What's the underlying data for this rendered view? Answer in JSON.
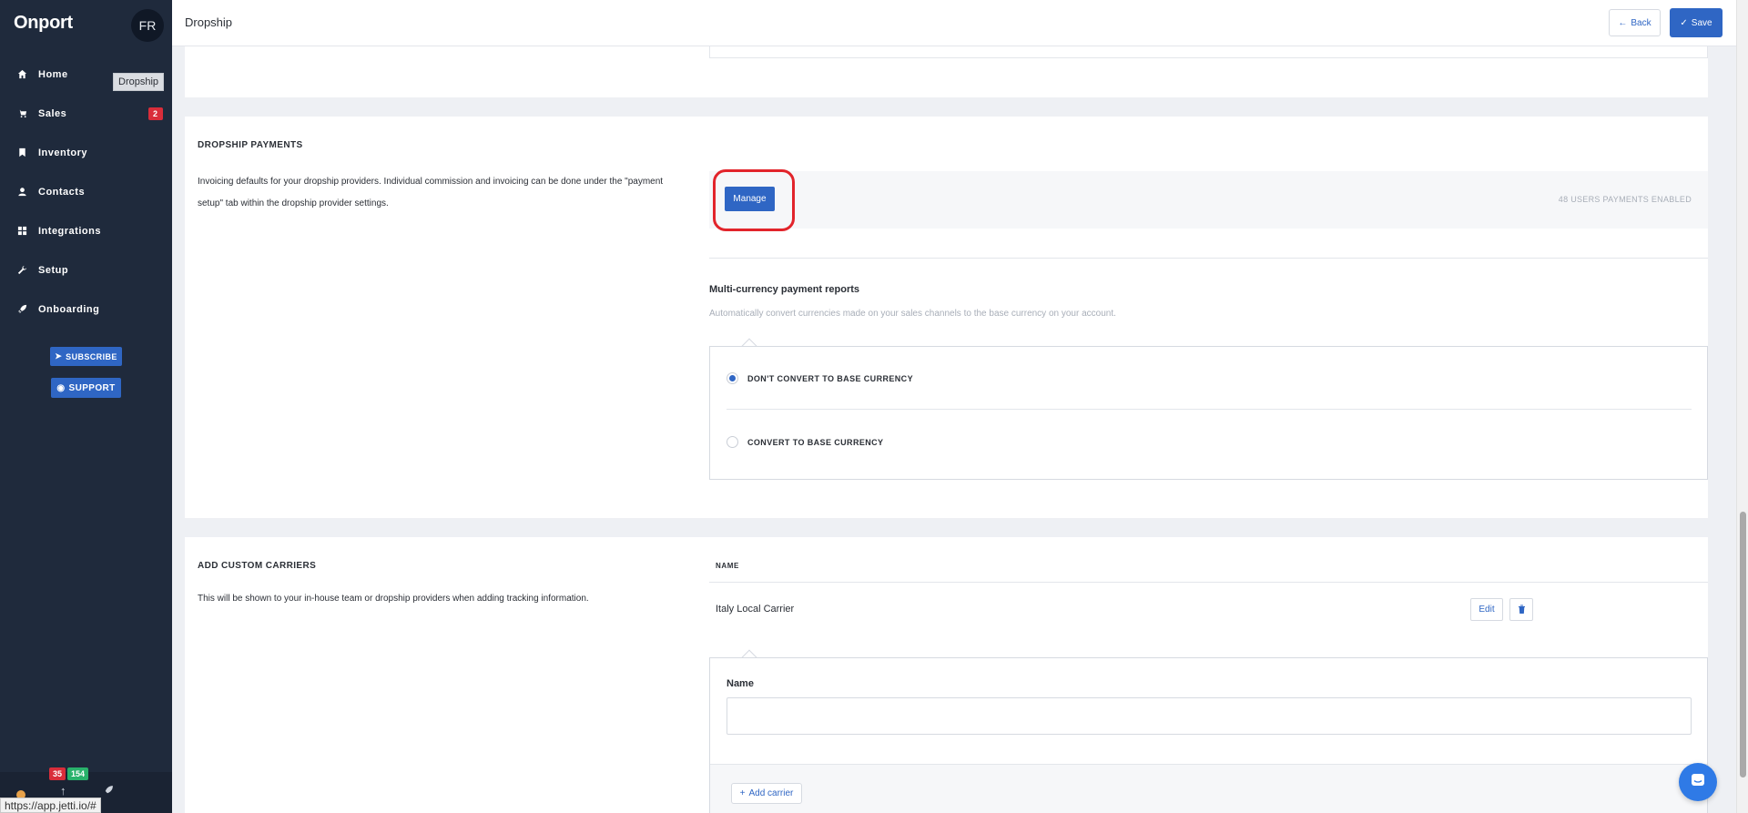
{
  "app": {
    "name": "Onport",
    "avatar_initials": "FR"
  },
  "sidebar": {
    "items": [
      {
        "label": "Home",
        "icon": "home-icon"
      },
      {
        "label": "Sales",
        "icon": "cart-icon",
        "badge": "2"
      },
      {
        "label": "Inventory",
        "icon": "bookmark-icon"
      },
      {
        "label": "Contacts",
        "icon": "user-icon"
      },
      {
        "label": "Integrations",
        "icon": "grid-icon"
      },
      {
        "label": "Setup",
        "icon": "wrench-icon"
      },
      {
        "label": "Onboarding",
        "icon": "rocket-icon"
      }
    ],
    "tooltip": "Dropship",
    "subscribe_label": "SUBSCRIBE",
    "support_label": "SUPPORT",
    "footer": {
      "red_count": "35",
      "green_count": "154"
    }
  },
  "header": {
    "title": "Dropship",
    "back_label": "Back",
    "save_label": "Save"
  },
  "payments": {
    "title": "DROPSHIP PAYMENTS",
    "description": "Invoicing defaults for your dropship providers. Individual commission and invoicing can be done under the \"payment setup\" tab within the dropship provider settings.",
    "manage_label": "Manage",
    "users_enabled": "48 USERS PAYMENTS ENABLED",
    "multicurrency": {
      "title": "Multi-currency payment reports",
      "description": "Automatically convert currencies made on your sales channels to the base currency on your account.",
      "options": [
        {
          "label": "DON'T CONVERT TO BASE CURRENCY",
          "selected": true
        },
        {
          "label": "CONVERT TO BASE CURRENCY",
          "selected": false
        }
      ]
    }
  },
  "carriers": {
    "title": "ADD CUSTOM CARRIERS",
    "description": "This will be shown to your in-house team or dropship providers when adding tracking information.",
    "column_header": "NAME",
    "rows": [
      {
        "name": "Italy Local Carrier",
        "edit_label": "Edit"
      }
    ],
    "form": {
      "name_label": "Name",
      "name_value": "",
      "add_label": "Add carrier"
    }
  },
  "status_bar_url": "https://app.jetti.io/#",
  "colors": {
    "sidebar": "#1f2a3c",
    "accent": "#2f66c4",
    "highlight": "#e2242b",
    "badge_red": "#d92d3a",
    "badge_green": "#29b26b"
  }
}
